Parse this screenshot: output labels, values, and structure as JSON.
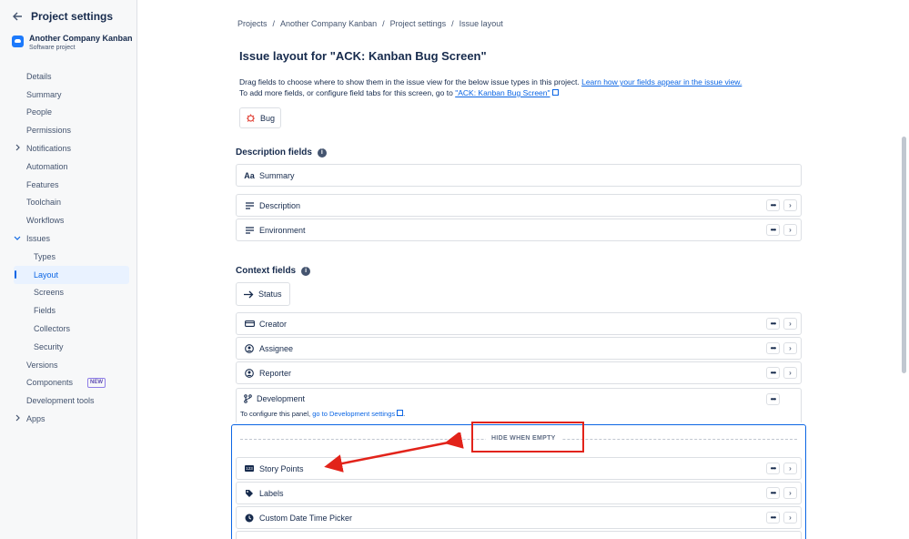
{
  "sidebar": {
    "title": "Project settings",
    "project_name": "Another Company Kanban",
    "project_type": "Software project",
    "items": [
      {
        "label": "Details"
      },
      {
        "label": "Summary"
      },
      {
        "label": "People"
      },
      {
        "label": "Permissions"
      },
      {
        "label": "Notifications"
      },
      {
        "label": "Automation"
      },
      {
        "label": "Features"
      },
      {
        "label": "Toolchain"
      },
      {
        "label": "Workflows"
      },
      {
        "label": "Issues"
      },
      {
        "label": "Types"
      },
      {
        "label": "Layout"
      },
      {
        "label": "Screens"
      },
      {
        "label": "Fields"
      },
      {
        "label": "Collectors"
      },
      {
        "label": "Security"
      },
      {
        "label": "Versions"
      },
      {
        "label": "Components",
        "badge": "NEW"
      },
      {
        "label": "Development tools"
      },
      {
        "label": "Apps"
      }
    ]
  },
  "breadcrumb": [
    "Projects",
    "/",
    "Another Company Kanban",
    "/",
    "Project settings",
    "/",
    "Issue layout"
  ],
  "page_title": "Issue layout for \"ACK: Kanban Bug Screen\"",
  "description": {
    "line1_prefix": "Drag fields to choose where to show them in the issue view for the below issue types in this project.",
    "line1_link": "Learn how your fields appear in the issue view.",
    "line2_prefix": "To add more fields, or configure field tabs for this screen, go to",
    "line2_link": "\"ACK: Kanban Bug Screen\""
  },
  "issue_type_chip": "Bug",
  "description_fields": {
    "title": "Description fields",
    "summary": "Summary",
    "summary_icon_text": "Aa",
    "items": [
      "Description",
      "Environment"
    ]
  },
  "context_fields": {
    "title": "Context fields",
    "status": "Status",
    "items": [
      "Creator",
      "Assignee",
      "Reporter"
    ],
    "development": "Development",
    "dev_note_prefix": "To configure this panel,",
    "dev_note_link": "go to Development settings",
    "dev_note_suffix": "."
  },
  "hide_when_empty": {
    "label": "HIDE WHEN EMPTY",
    "icon_text_123": "123",
    "items": [
      "Story Points",
      "Labels",
      "Custom Date Time Picker"
    ]
  },
  "buttons": {
    "more": "•••",
    "go": "›"
  },
  "colors": {
    "accent": "#0c66e4",
    "annotation_red": "#e2231a"
  }
}
